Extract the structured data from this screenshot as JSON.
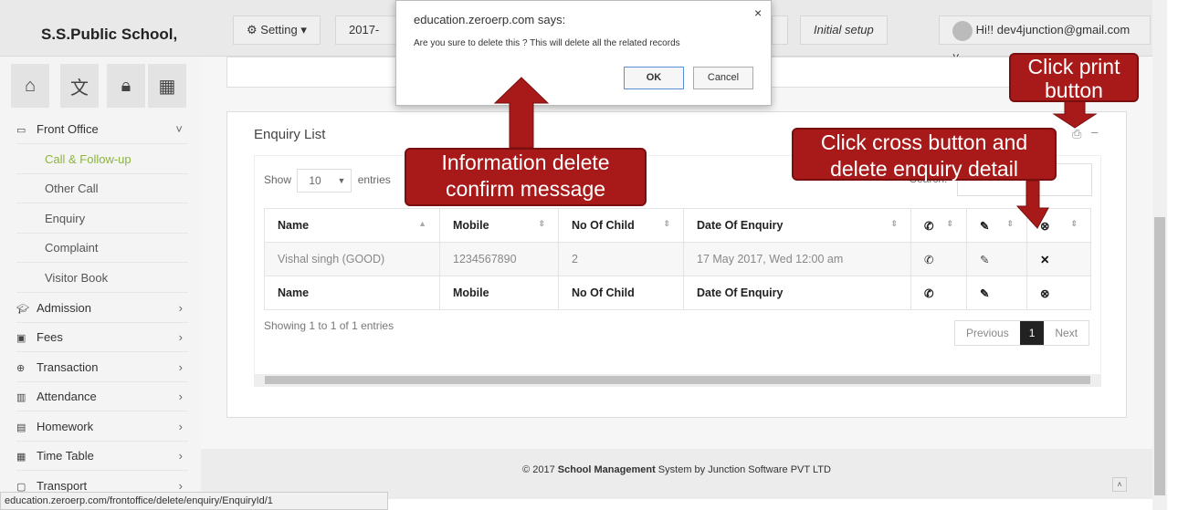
{
  "header": {
    "brand": "S.S.Public School,",
    "setting": "Setting",
    "session": "2017-201",
    "initial_setup": "Initial setup",
    "user": "Hi!! dev4junction@gmail.com"
  },
  "sidebar": {
    "front_office": "Front Office",
    "sub": [
      "Call & Follow-up",
      "Other Call",
      "Enquiry",
      "Complaint",
      "Visitor Book"
    ],
    "items": [
      {
        "label": "Admission",
        "icon": "graduation-cap-icon"
      },
      {
        "label": "Fees",
        "icon": "money-icon"
      },
      {
        "label": "Transaction",
        "icon": "globe-icon"
      },
      {
        "label": "Attendance",
        "icon": "bar-chart-icon"
      },
      {
        "label": "Homework",
        "icon": "file-icon"
      },
      {
        "label": "Time Table",
        "icon": "calendar-icon"
      },
      {
        "label": "Transport",
        "icon": "bus-icon"
      }
    ]
  },
  "panel": {
    "title": "Enquiry List",
    "show": "Show",
    "entries_value": "10",
    "entries": "entries",
    "search": "Search:",
    "columns": [
      "Name",
      "Mobile",
      "No Of Child",
      "Date Of Enquiry"
    ],
    "rows": [
      [
        "Vishal singh (GOOD)",
        "1234567890",
        "2",
        "17 May 2017, Wed 12:00 am"
      ]
    ],
    "info": "Showing 1 to 1 of 1 entries",
    "previous": "Previous",
    "page": "1",
    "next": "Next"
  },
  "footer": {
    "pre": "© 2017 ",
    "bold": "School Management",
    "post": " System by Junction Software PVT LTD"
  },
  "status_url": "education.zeroerp.com/frontoffice/delete/enquiry/EnquiryId/1",
  "dialog": {
    "title": "education.zeroerp.com says:",
    "message": "Are you sure to delete this ? This will delete all the related records",
    "ok": "OK",
    "cancel": "Cancel",
    "close": "×"
  },
  "callouts": {
    "print": "Click print button",
    "cross": "Click cross button and delete enquiry detail",
    "confirm": "Information delete confirm message"
  },
  "colors": {
    "callout": "#a81a1a",
    "active_menu": "#8cb43c"
  }
}
